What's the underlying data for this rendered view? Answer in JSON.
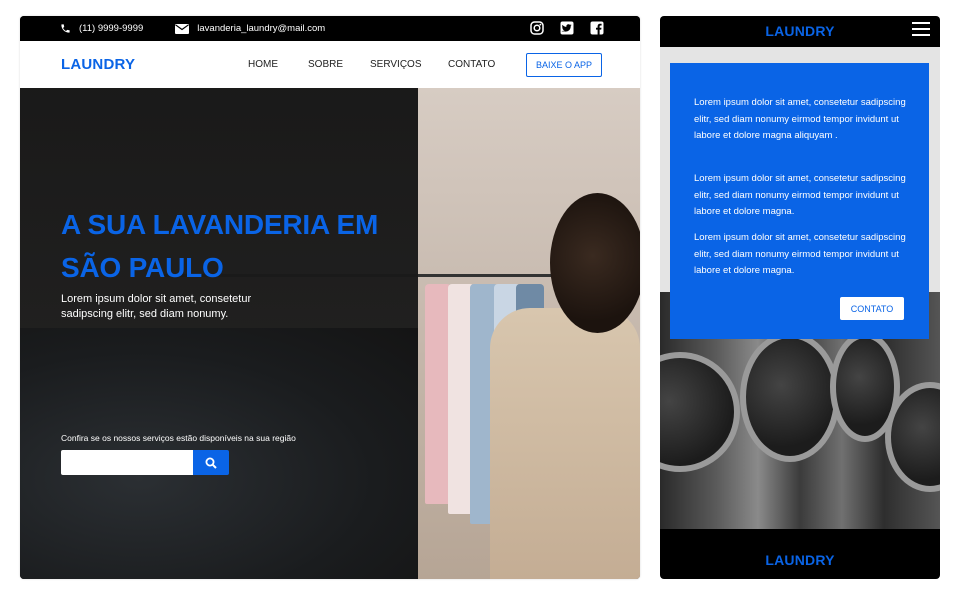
{
  "desktop": {
    "topbar": {
      "phone": "(11) 9999-9999",
      "email": "lavanderia_laundry@mail.com",
      "socials": [
        "instagram-icon",
        "twitter-icon",
        "facebook-icon"
      ]
    },
    "nav": {
      "logo": "LAUNDRY",
      "links": [
        "HOME",
        "SOBRE",
        "SERVIÇOS",
        "CONTATO"
      ],
      "cta": "BAIXE O APP"
    },
    "hero": {
      "title_line1": "A SUA LAVANDERIA EM",
      "title_line2": "SÃO PAULO",
      "subtitle": "Lorem ipsum dolor sit amet, consetetur sadipscing elitr, sed diam nonumy.",
      "search_label": "Confira se os nossos serviços estão disponíveis na sua região",
      "search_value": ""
    }
  },
  "mobile": {
    "header_logo": "LAUNDRY",
    "card": {
      "p1": "Lorem ipsum dolor sit amet, consetetur sadipscing elitr, sed diam nonumy eirmod tempor invidunt ut labore et dolore magna aliquyam .",
      "p2": "Lorem ipsum dolor sit amet, consetetur sadipscing elitr, sed diam nonumy eirmod tempor invidunt ut labore et dolore magna.",
      "p3": "Lorem ipsum dolor sit amet, consetetur sadipscing elitr, sed diam nonumy eirmod tempor invidunt ut labore et dolore magna.",
      "button": "CONTATO"
    },
    "footer_logo": "LAUNDRY"
  },
  "colors": {
    "accent": "#0a64e6",
    "dark": "#000000"
  }
}
